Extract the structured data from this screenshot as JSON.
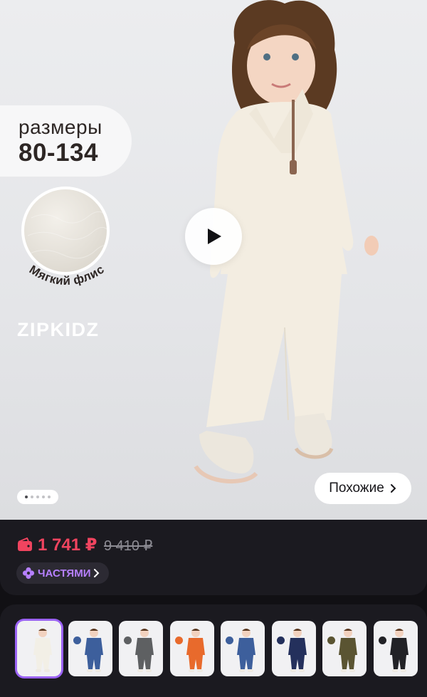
{
  "hero": {
    "sizes_label": "размеры",
    "sizes_value": "80-134",
    "fleece_label": "Мягкий флис",
    "brand": "ZIPKIDZ",
    "slides_total": 5,
    "slide_active": 1,
    "similar_label": "Похожие"
  },
  "price": {
    "current": "1 741 ₽",
    "old": "9 410 ₽",
    "parts_label": "ЧАСТЯМИ"
  },
  "colors": {
    "accent_price": "#f0445f",
    "accent_parts": "#b680ff",
    "selected_border": "#9b63f5"
  },
  "thumbnails": [
    {
      "color": "#f2efe6",
      "selected": true
    },
    {
      "color": "#3d5f9c",
      "selected": false
    },
    {
      "color": "#5e6062",
      "selected": false
    },
    {
      "color": "#e86a2c",
      "selected": false
    },
    {
      "color": "#3d5f9c",
      "selected": false
    },
    {
      "color": "#24305c",
      "selected": false
    },
    {
      "color": "#5a5432",
      "selected": false
    },
    {
      "color": "#222226",
      "selected": false
    }
  ]
}
